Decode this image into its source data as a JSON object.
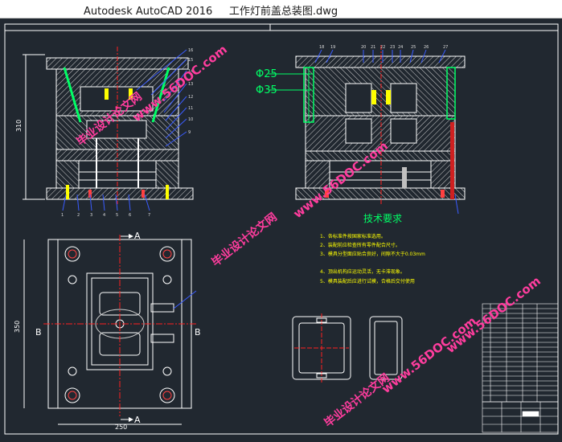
{
  "window": {
    "title": "Autodesk AutoCAD 2016     工作灯前盖总装图.dwg"
  },
  "dimensions": {
    "front_height": "310",
    "plan_height": "350",
    "plan_width": "250",
    "dia_top": "Φ25",
    "dia_bottom": "Φ35"
  },
  "section_marks": {
    "a": "A",
    "b": "B"
  },
  "tech": {
    "heading": "技术要求",
    "items": [
      "1、各标准件按国家标准选用。",
      "2、装配前应检查所有零件配合尺寸。",
      "3、模具分型面应贴合良好，间隙不大于0.03mm",
      "4、顶出机构应运动灵活，无卡滞现象。",
      "5、模具装配后应进行试模，合格后交付使用"
    ]
  },
  "balloons": {
    "front_top": [
      "16",
      "15",
      "14",
      "13",
      "12",
      "11",
      "10",
      "9"
    ],
    "front_bottom": [
      "1",
      "2",
      "3",
      "4",
      "5",
      "6",
      "7"
    ],
    "side_top": [
      "18",
      "19",
      "20",
      "21",
      "22",
      "23",
      "24",
      "25",
      "26",
      "27"
    ]
  },
  "watermark": {
    "site": "www.56DOC.com",
    "school": "毕业设计论文网"
  },
  "colors": {
    "background": "#212830",
    "line": "#ffffff",
    "center": "#ff2020",
    "green": "#00ff66",
    "cyan": "#00ffff",
    "yellow": "#ffff00",
    "blue": "#3a5cff",
    "watermark_pink": "#ff3d9e"
  }
}
